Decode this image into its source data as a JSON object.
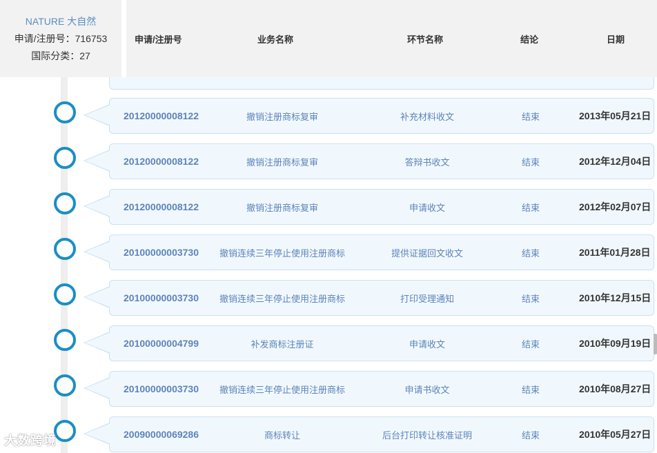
{
  "info": {
    "brand": "NATURE 大自然",
    "reg_line": "申请/注册号：716753",
    "class_line": "国际分类：27"
  },
  "header": {
    "reg_no": "申请/注册号",
    "business": "业务名称",
    "step": "环节名称",
    "result": "结论",
    "date": "日期"
  },
  "rows": [
    {
      "reg_no": "20120000008122",
      "business": "撤销注册商标复审",
      "step": "补充材料收文",
      "result": "结束",
      "date": "2013年05月21日"
    },
    {
      "reg_no": "20120000008122",
      "business": "撤销注册商标复审",
      "step": "答辩书收文",
      "result": "结束",
      "date": "2012年12月04日"
    },
    {
      "reg_no": "20120000008122",
      "business": "撤销注册商标复审",
      "step": "申请收文",
      "result": "结束",
      "date": "2012年02月07日"
    },
    {
      "reg_no": "20100000003730",
      "business": "撤销连续三年停止使用注册商标",
      "step": "提供证据回文收文",
      "result": "结束",
      "date": "2011年01月28日"
    },
    {
      "reg_no": "20100000003730",
      "business": "撤销连续三年停止使用注册商标",
      "step": "打印受理通知",
      "result": "结束",
      "date": "2010年12月15日"
    },
    {
      "reg_no": "20100000004799",
      "business": "补发商标注册证",
      "step": "申请收文",
      "result": "结束",
      "date": "2010年09月19日"
    },
    {
      "reg_no": "20100000003730",
      "business": "撤销连续三年停止使用注册商标",
      "step": "申请书收文",
      "result": "结束",
      "date": "2010年08月27日"
    },
    {
      "reg_no": "20090000069286",
      "business": "商标转让",
      "step": "后台打印转让核准证明",
      "result": "结束",
      "date": "2010年05月27日"
    }
  ],
  "watermark": "大数跨境",
  "colors": {
    "accent": "#1a8ec5",
    "link": "#5c84ba",
    "row_bg": "#f1f8fd",
    "header_bg": "#f2f2f2"
  }
}
